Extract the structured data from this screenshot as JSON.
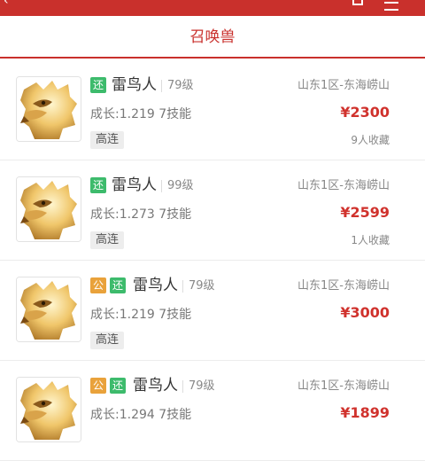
{
  "header": {
    "title": "",
    "tab_label": "召唤兽"
  },
  "colors": {
    "accent": "#c9302c",
    "price": "#d0322d",
    "badge_huan": "#3dbb6c",
    "badge_gong": "#e9a23b"
  },
  "listings": [
    {
      "badges": [
        "还"
      ],
      "name": "雷鸟人",
      "level": "79级",
      "growth": "成长:1.219 7技能",
      "tag": "高连",
      "server": "山东1区-东海崂山",
      "price": "¥2300",
      "favorites": "9人收藏"
    },
    {
      "badges": [
        "还"
      ],
      "name": "雷鸟人",
      "level": "99级",
      "growth": "成长:1.273 7技能",
      "tag": "高连",
      "server": "山东1区-东海崂山",
      "price": "¥2599",
      "favorites": "1人收藏"
    },
    {
      "badges": [
        "公",
        "还"
      ],
      "name": "雷鸟人",
      "level": "79级",
      "growth": "成长:1.219 7技能",
      "tag": "高连",
      "server": "山东1区-东海崂山",
      "price": "¥3000",
      "favorites": ""
    },
    {
      "badges": [
        "公",
        "还"
      ],
      "name": "雷鸟人",
      "level": "79级",
      "growth": "成长:1.294 7技能",
      "tag": "",
      "server": "山东1区-东海崂山",
      "price": "¥1899",
      "favorites": ""
    }
  ]
}
